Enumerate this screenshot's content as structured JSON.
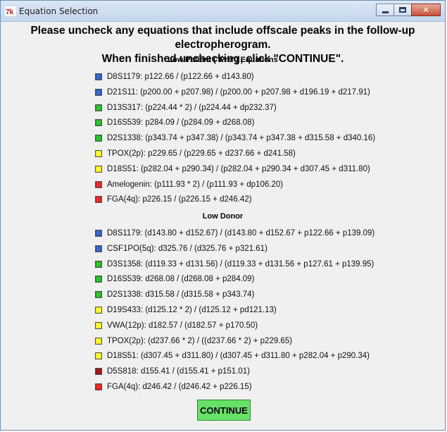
{
  "window": {
    "title": "Equation Selection",
    "app_icon": "tk-feather-icon",
    "controls": [
      "minimize-icon",
      "maximize-icon",
      "close-icon"
    ]
  },
  "instructions": {
    "line1": "Please uncheck any equations that include offscale peaks in the follow-up electropherogram.",
    "line2": "When finished unchecking, click \"CONTINUE\"."
  },
  "colors": {
    "blue": "#2a55a8",
    "green": "#1ea21e",
    "yellow": "#f0dc1e",
    "red": "#d02020",
    "dark_red": "#8b1212",
    "continue_bg": "#66e066"
  },
  "sections": [
    {
      "header": "Low Patient (\"Pre\") Equations",
      "equations": [
        {
          "color": "#2a55a8",
          "text": "D8S1179:  p122.66 / (p122.66 + d143.80)"
        },
        {
          "color": "#2a55a8",
          "text": "D21S11:  (p200.00 + p207.98) / (p200.00 + p207.98 + d196.19 + d217.91)"
        },
        {
          "color": "#1ea21e",
          "text": "D13S317:  (p224.44 * 2) / (p224.44 + dp232.37)"
        },
        {
          "color": "#1ea21e",
          "text": "D16S539:  p284.09 / (p284.09 + d268.08)"
        },
        {
          "color": "#1ea21e",
          "text": "D2S1338:  (p343.74 + p347.38) / (p343.74 + p347.38 + d315.58 + d340.16)"
        },
        {
          "color": "#f0dc1e",
          "text": "TPOX(2p):  p229.65 / (p229.65 + d237.66 + d241.58)"
        },
        {
          "color": "#f0dc1e",
          "text": "D18S51:  (p282.04 + p290.34) / (p282.04 + p290.34 + d307.45 + d311.80)"
        },
        {
          "color": "#d02020",
          "text": "Amelogenin:  (p111.93 * 2) / (p111.93 + dp106.20)"
        },
        {
          "color": "#d02020",
          "text": "FGA(4q):  p226.15 / (p226.15 + d246.42)"
        }
      ]
    },
    {
      "header": "Low Donor",
      "equations": [
        {
          "color": "#2a55a8",
          "text": "D8S1179:  (d143.80 + d152.67) / (d143.80 + d152.67 + p122.66 + p139.09)"
        },
        {
          "color": "#2a55a8",
          "text": "CSF1PO(5q):  d325.76 / (d325.76 + p321.61)"
        },
        {
          "color": "#1ea21e",
          "text": "D3S1358:  (d119.33 + d131.56) / (d119.33 + d131.56 + p127.61 + p139.95)"
        },
        {
          "color": "#1ea21e",
          "text": "D16S539:  d268.08 / (d268.08 + p284.09)"
        },
        {
          "color": "#1ea21e",
          "text": "D2S1338:  d315.58 / (d315.58 + p343.74)"
        },
        {
          "color": "#f0dc1e",
          "text": "D19S433:  (d125.12 * 2) / (d125.12 + pd121.13)"
        },
        {
          "color": "#f0dc1e",
          "text": "VWA(12p):  d182.57 / (d182.57 + p170.50)"
        },
        {
          "color": "#f0dc1e",
          "text": "TPOX(2p):  (d237.66 * 2) / ((d237.66 * 2) + p229.65)"
        },
        {
          "color": "#f0dc1e",
          "text": "D18S51:  (d307.45 + d311.80) / (d307.45 + d311.80 + p282.04 + p290.34)"
        },
        {
          "color": "#8b1212",
          "text": "D5S818:  d155.41 / (d155.41 + p151.01)"
        },
        {
          "color": "#d02020",
          "text": "FGA(4q):  d246.42 / (d246.42 + p226.15)"
        }
      ]
    }
  ],
  "continue_label": "CONTINUE"
}
